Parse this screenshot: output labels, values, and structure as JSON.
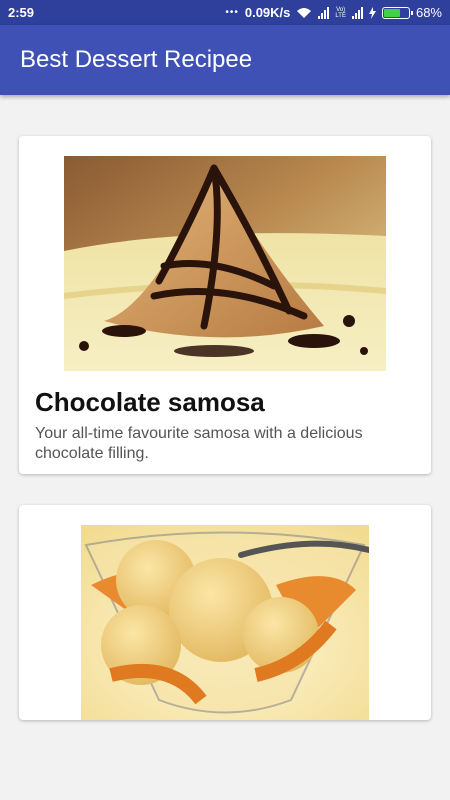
{
  "status_bar": {
    "time": "2:59",
    "speed": "0.09K/s",
    "carrier_label": "Vo)) LTE",
    "battery": "68%",
    "battery_level": 0.68
  },
  "app_bar": {
    "title": "Best Dessert Recipee"
  },
  "cards": [
    {
      "title": "Chocolate samosa",
      "description": "Your all-time favourite samosa with a delicious chocolate filling.",
      "image_icon": "chocolate-samosa-image"
    },
    {
      "title": "",
      "description": "",
      "image_icon": "ice-cream-image"
    }
  ],
  "colors": {
    "status_bar": "#2f3f9c",
    "app_bar": "#3f51b5",
    "background": "#f2f2f2"
  }
}
